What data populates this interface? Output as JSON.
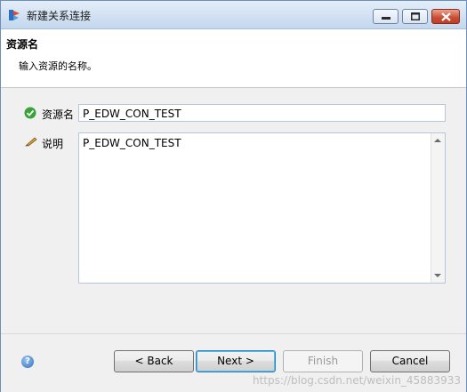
{
  "window": {
    "title": "新建关系连接"
  },
  "header": {
    "title": "资源名",
    "description": "输入资源的名称。"
  },
  "form": {
    "resource_name_label": "资源名",
    "resource_name_value": "P_EDW_CON_TEST",
    "description_label": "说明",
    "description_value": "P_EDW_CON_TEST"
  },
  "buttons": {
    "back": "< Back",
    "next": "Next >",
    "finish": "Finish",
    "cancel": "Cancel"
  },
  "icons": {
    "app": "app-icon",
    "minimize": "minimize-icon",
    "maximize": "maximize-icon",
    "close": "close-icon",
    "valid": "check-circle-icon",
    "edit": "pencil-icon",
    "help": "help-icon"
  },
  "watermark": "https://blog.csdn.net/weixin_45883933"
}
